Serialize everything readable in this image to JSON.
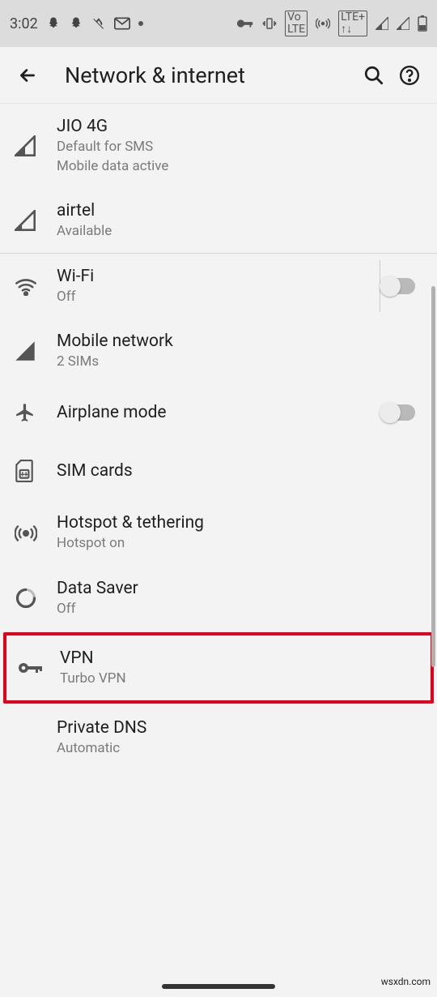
{
  "statusbar": {
    "time": "3:02",
    "right_indicators": [
      "key",
      "vibrate",
      "volte",
      "hotspot",
      "lte",
      "signal1",
      "signal2",
      "battery"
    ]
  },
  "header": {
    "title": "Network & internet"
  },
  "sims": [
    {
      "label": "JIO 4G",
      "sub1": "Default for SMS",
      "sub2": "Mobile data active"
    },
    {
      "label": "airtel",
      "sub1": "Available"
    }
  ],
  "items": {
    "wifi": {
      "label": "Wi-Fi",
      "sub": "Off",
      "toggle": false
    },
    "mobile": {
      "label": "Mobile network",
      "sub": "2 SIMs"
    },
    "airplane": {
      "label": "Airplane mode",
      "toggle": false
    },
    "sim": {
      "label": "SIM cards"
    },
    "hotspot": {
      "label": "Hotspot & tethering",
      "sub": "Hotspot on"
    },
    "datasaver": {
      "label": "Data Saver",
      "sub": "Off"
    },
    "vpn": {
      "label": "VPN",
      "sub": "Turbo VPN"
    },
    "dns": {
      "label": "Private DNS",
      "sub": "Automatic"
    }
  },
  "watermark": "wsxdn.com"
}
